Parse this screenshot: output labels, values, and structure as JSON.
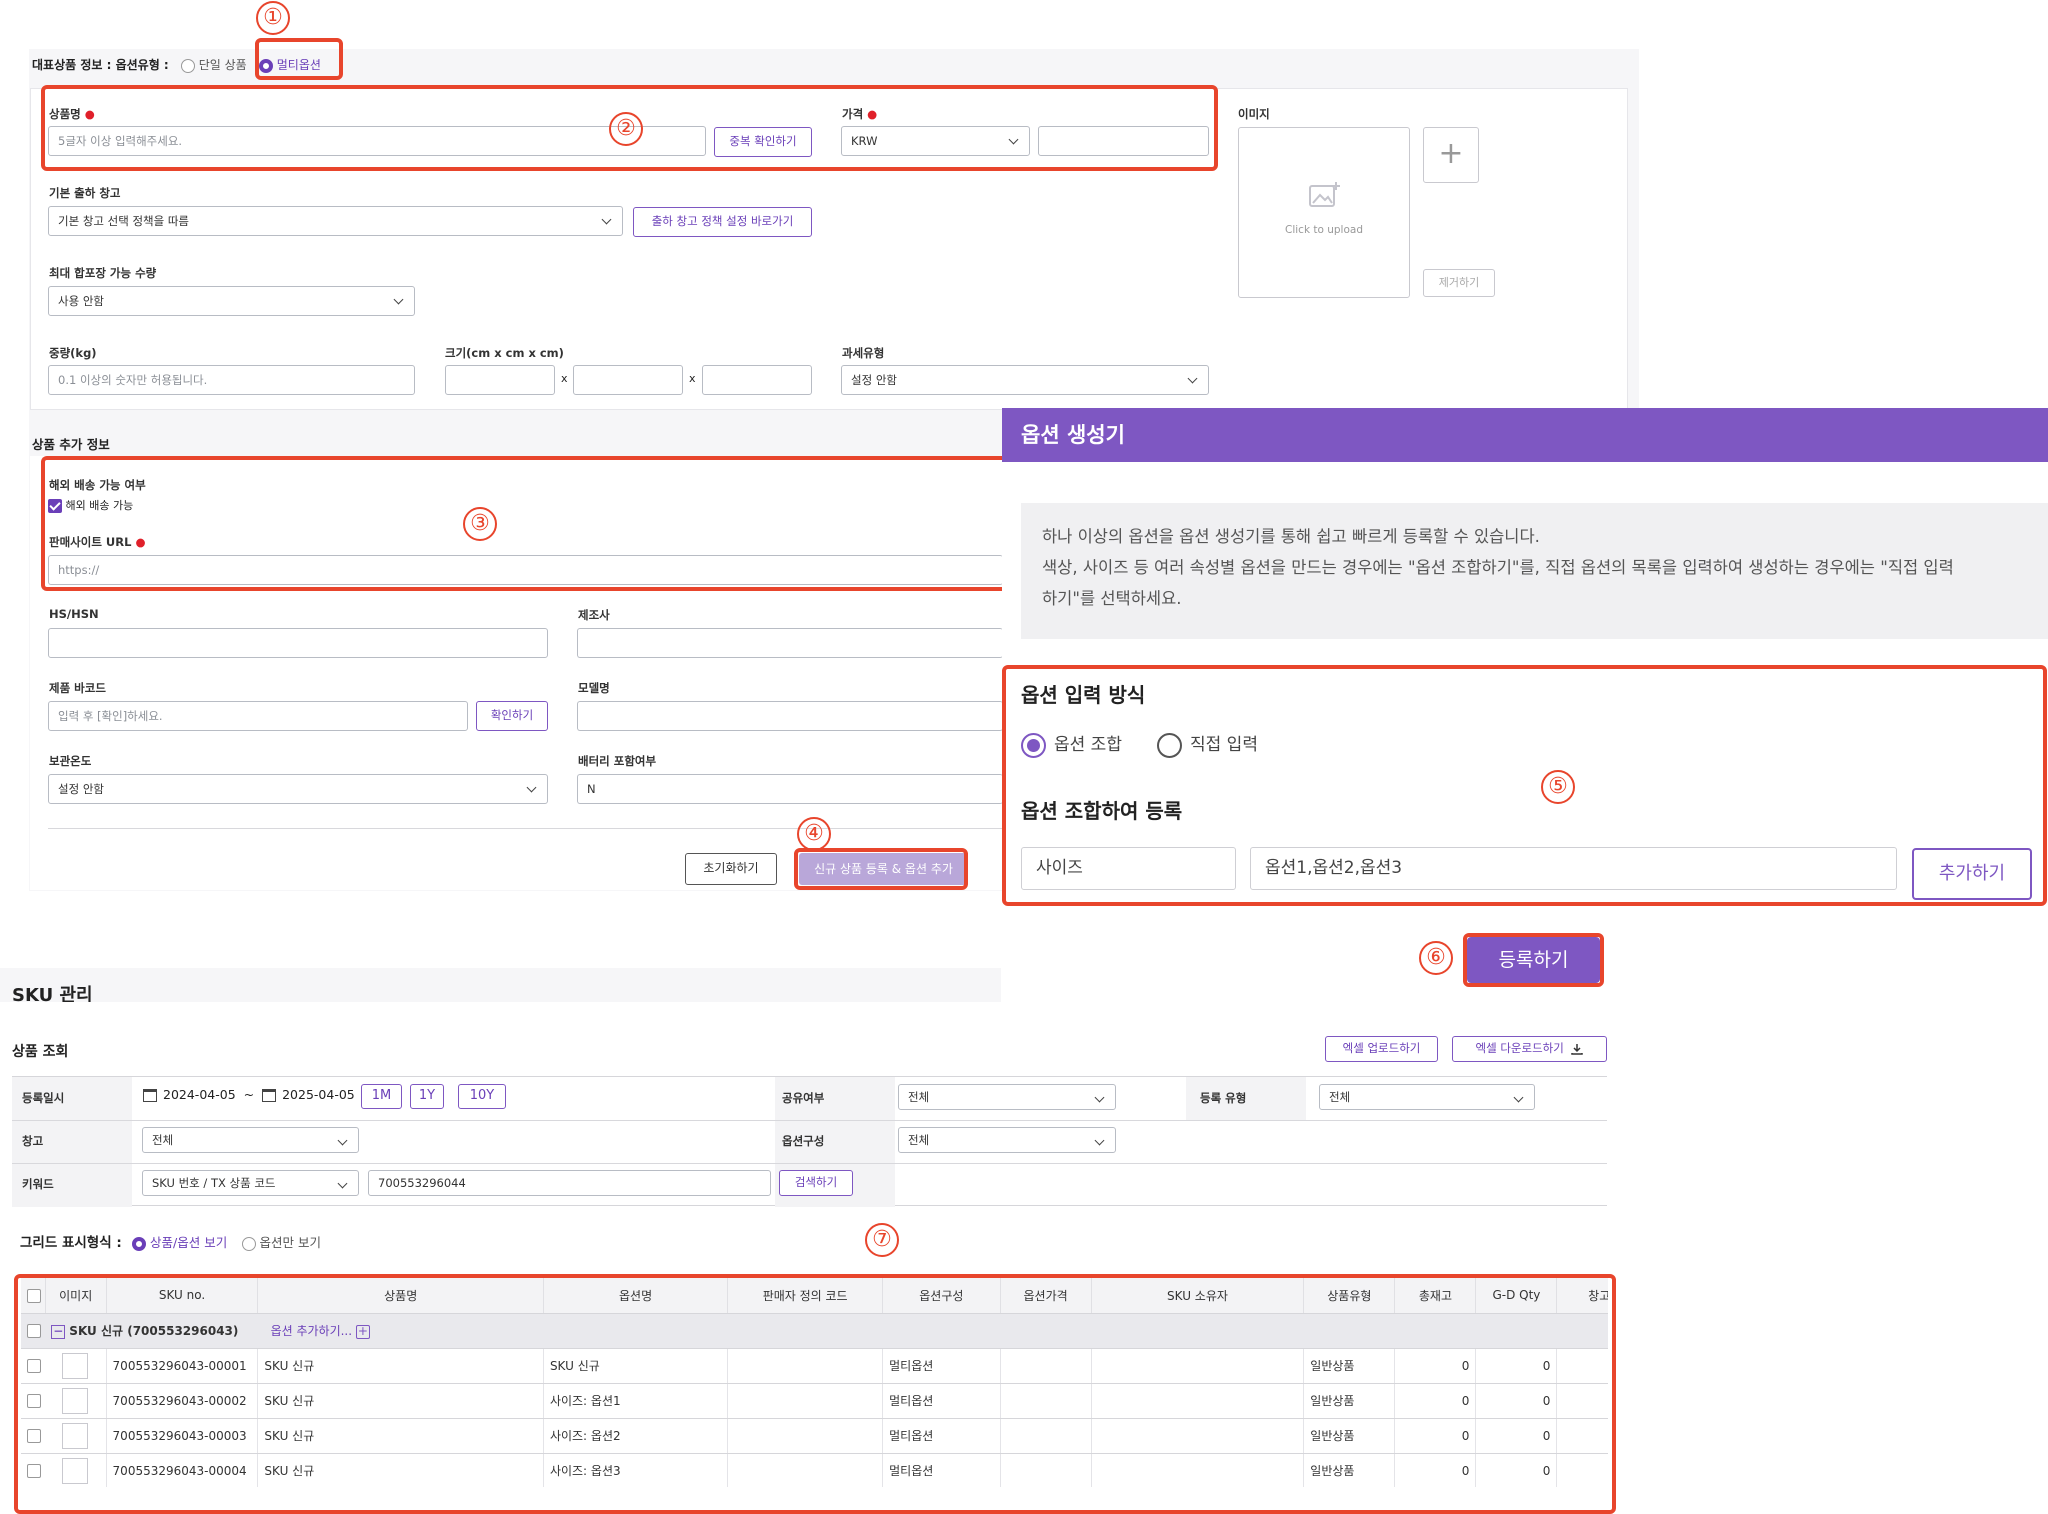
{
  "product_form": {
    "section_title": "대표상품 정보 : 옵션유형 :",
    "option_type_single": "단일 상품",
    "option_type_multi": "멀티옵션",
    "name_label": "상품명",
    "name_placeholder": "5글자 이상 입력해주세요.",
    "dup_check_button": "중복 확인하기",
    "price_label": "가격",
    "currency_value": "KRW",
    "image_label": "이미지",
    "upload_text": "Click to upload",
    "remove_button": "제거하기",
    "warehouse_label": "기본 출하 창고",
    "warehouse_value": "기본 창고 선택 정책을 따름",
    "warehouse_policy_button": "출하 창고 정책 설정 바로가기",
    "max_pack_label": "최대 합포장 가능 수량",
    "max_pack_value": "사용 안함",
    "weight_label": "중량(kg)",
    "weight_placeholder": "0.1 이상의 숫자만 허용됩니다.",
    "size_label": "크기(cm x cm x cm)",
    "x_sep": "x",
    "tax_label": "과세유형",
    "tax_value": "설정 안함"
  },
  "extra_info": {
    "title": "상품 추가 정보",
    "overseas_label": "해외 배송 가능 여부",
    "overseas_checkbox": "해외 배송 가능",
    "site_url_label": "판매사이트 URL",
    "site_url_placeholder": "https://",
    "hs_label": "HS/HSN",
    "maker_label": "제조사",
    "barcode_label": "제품 바코드",
    "barcode_placeholder": "입력 후 [확인]하세요.",
    "confirm_button": "확인하기",
    "model_label": "모델명",
    "storage_label": "보관온도",
    "storage_value": "설정 안함",
    "battery_label": "배터리 포함여부",
    "battery_value": "N",
    "reset_button": "초기화하기",
    "register_button": "신규 상품 등록 & 옵션 추가"
  },
  "option_generator": {
    "title": "옵션 생성기",
    "description": "하나 이상의 옵션을 옵션 생성기를 통해 쉽고 빠르게 등록할 수 있습니다.",
    "description2": "색상, 사이즈 등 여러 속성별 옵션을 만드는 경우에는 \"옵션 조합하기\"를, 직접 옵션의 목록을 입력하여 생성하는 경우에는 \"직접 입력",
    "description3": "하기\"를 선택하세요.",
    "input_method_title": "옵션 입력 방식",
    "method_combine": "옵션 조합",
    "method_direct": "직접 입력",
    "combine_title": "옵션 조합하여 등록",
    "option_name_value": "사이즈",
    "option_values_value": "옵션1,옵션2,옵션3",
    "add_button": "추가하기",
    "submit_button": "등록하기"
  },
  "sku": {
    "title": "SKU 관리",
    "search_title": "상품 조회",
    "excel_upload": "엑셀 업로드하기",
    "excel_download": "엑셀 다운로드하기",
    "filters": {
      "reg_date_label": "등록일시",
      "date_from": "2024-04-05",
      "tilde": "~",
      "date_to": "2025-04-05",
      "range_1m": "1M",
      "range_1y": "1Y",
      "range_10y": "10Y",
      "share_label": "공유여부",
      "share_value": "전체",
      "reg_type_label": "등록 유형",
      "reg_type_value": "전체",
      "warehouse_label": "창고",
      "warehouse_value": "전체",
      "option_config_label": "옵션구성",
      "option_config_value": "전체",
      "keyword_label": "키워드",
      "keyword_type_value": "SKU 번호 / TX 상품 코드",
      "keyword_value": "700553296044",
      "search_button": "검색하기"
    },
    "grid_display_label": "그리드 표시형식 :",
    "view_product_option": "상품/옵션 보기",
    "view_option_only": "옵션만 보기",
    "columns": [
      "이미지",
      "SKU no.",
      "상품명",
      "옵션명",
      "판매자 정의 코드",
      "옵션구성",
      "옵션가격",
      "SKU 소유자",
      "상품유형",
      "총재고",
      "G-D Qty",
      "창고"
    ],
    "group_label": "SKU 신규 (700553296043)",
    "add_option_link": "옵션 추가하기...",
    "rows": [
      {
        "sku": "700553296043-00001",
        "name": "SKU 신규",
        "option": "SKU 신규",
        "config": "멀티옵션",
        "type": "일반상품",
        "stock": "0",
        "gd": "0"
      },
      {
        "sku": "700553296043-00002",
        "name": "SKU 신규",
        "option": "사이즈: 옵션1",
        "config": "멀티옵션",
        "type": "일반상품",
        "stock": "0",
        "gd": "0"
      },
      {
        "sku": "700553296043-00003",
        "name": "SKU 신규",
        "option": "사이즈: 옵션2",
        "config": "멀티옵션",
        "type": "일반상품",
        "stock": "0",
        "gd": "0"
      },
      {
        "sku": "700553296043-00004",
        "name": "SKU 신규",
        "option": "사이즈: 옵션3",
        "config": "멀티옵션",
        "type": "일반상품",
        "stock": "0",
        "gd": "0"
      }
    ]
  },
  "markers": [
    "①",
    "②",
    "③",
    "④",
    "⑤",
    "⑥",
    "⑦"
  ],
  "colors": {
    "accent": "#7e57c2",
    "highlight": "#e8452c",
    "header_bar": "#7e57c2"
  }
}
